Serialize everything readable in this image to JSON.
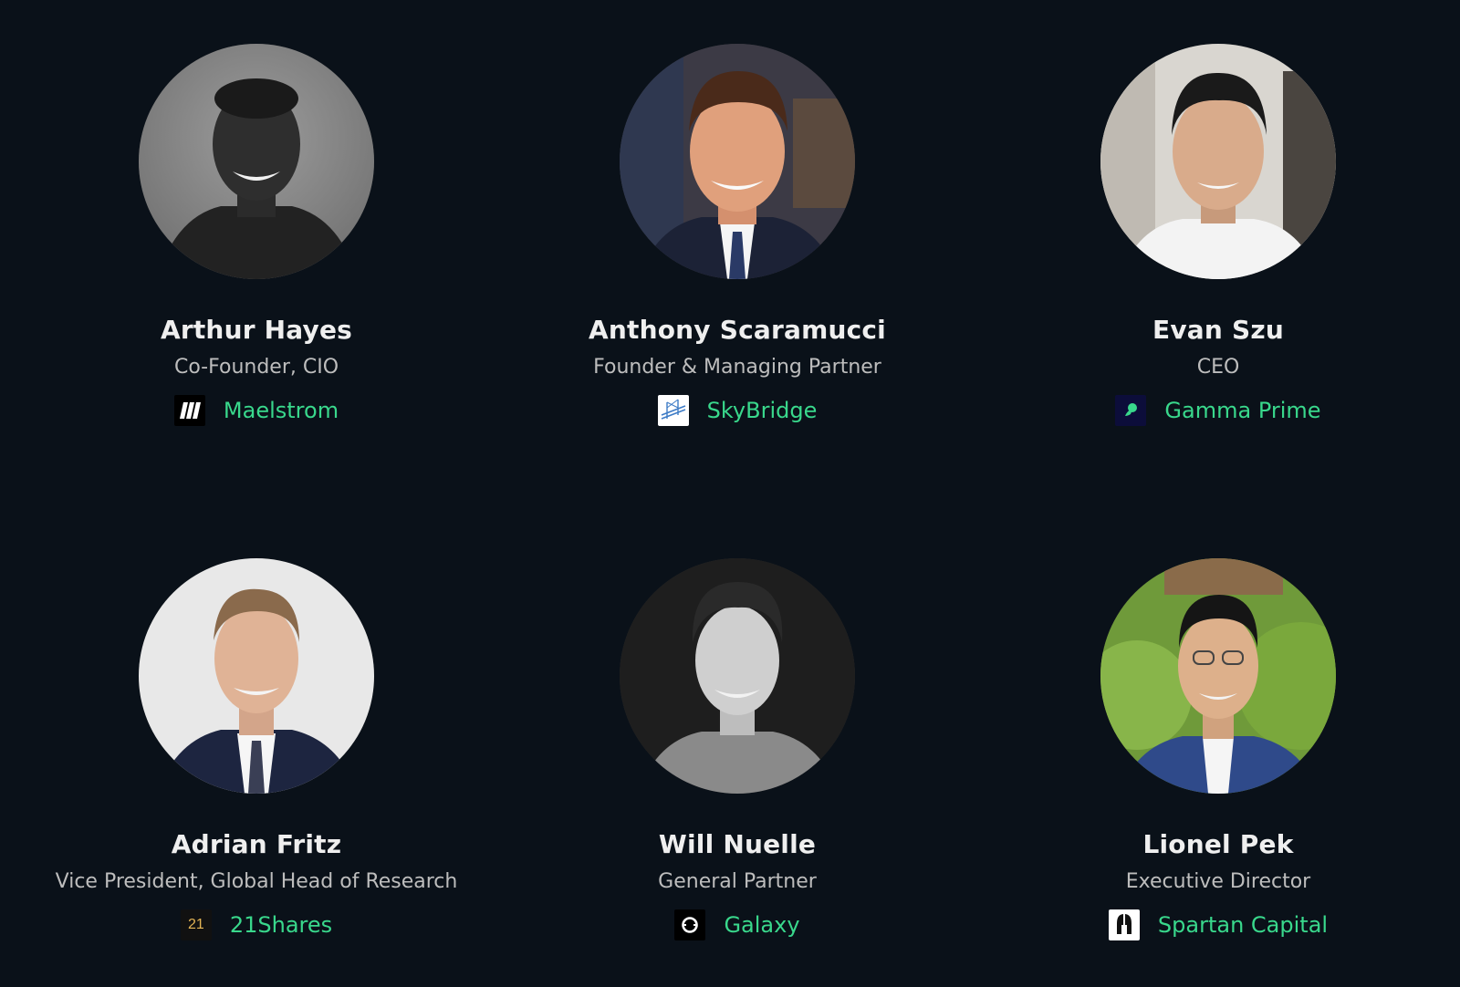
{
  "theme": {
    "background": "#0a1119",
    "accent": "#39d88c",
    "name_color": "#efefef",
    "title_color": "#bdbdbd"
  },
  "speakers": [
    {
      "name": "Arthur Hayes",
      "title": "Co-Founder, CIO",
      "company": "Maelstrom",
      "logo_icon": "maelstrom-logo-icon"
    },
    {
      "name": "Anthony Scaramucci",
      "title": "Founder & Managing Partner",
      "company": "SkyBridge",
      "logo_icon": "skybridge-logo-icon"
    },
    {
      "name": "Evan Szu",
      "title": "CEO",
      "company": "Gamma Prime",
      "logo_icon": "gamma-prime-logo-icon"
    },
    {
      "name": "Adrian Fritz",
      "title": "Vice President, Global Head of Research",
      "company": "21Shares",
      "logo_icon": "21shares-logo-icon",
      "logo_text": "21"
    },
    {
      "name": "Will Nuelle",
      "title": "General Partner",
      "company": "Galaxy",
      "logo_icon": "galaxy-logo-icon"
    },
    {
      "name": "Lionel Pek",
      "title": "Executive Director",
      "company": "Spartan Capital",
      "logo_icon": "spartan-capital-logo-icon"
    }
  ]
}
